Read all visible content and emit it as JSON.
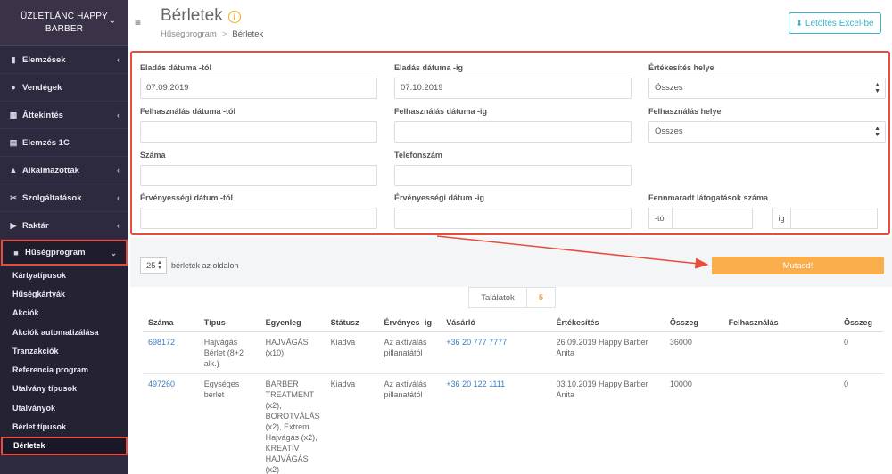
{
  "brand": {
    "title": "ÜZLETLÁNC HAPPY BARBER"
  },
  "sidebar": {
    "items": [
      {
        "label": "Elemzések",
        "icon": "bar-chart-icon",
        "glyph": "▮",
        "chevron": true
      },
      {
        "label": "Vendégek",
        "icon": "users-icon",
        "glyph": "●",
        "chevron": false
      },
      {
        "label": "Áttekintés",
        "icon": "grid-icon",
        "glyph": "▦",
        "chevron": true
      },
      {
        "label": "Elemzés 1C",
        "icon": "document-icon",
        "glyph": "▤",
        "chevron": false
      },
      {
        "label": "Alkalmazottak",
        "icon": "user-icon",
        "glyph": "▲",
        "chevron": true
      },
      {
        "label": "Szolgáltatások",
        "icon": "scissors-icon",
        "glyph": "✂",
        "chevron": true
      },
      {
        "label": "Raktár",
        "icon": "truck-icon",
        "glyph": "▶",
        "chevron": true
      },
      {
        "label": "Hűségprogram",
        "icon": "gift-icon",
        "glyph": "■",
        "chevron": true,
        "active": true
      }
    ],
    "subitems": [
      "Kártyatípusok",
      "Hűségkártyák",
      "Akciók",
      "Akciók automatizálása",
      "Tranzakciók",
      "Referencia program",
      "Utalvány típusok",
      "Utalványok",
      "Bérlet típusok",
      "Bérletek"
    ],
    "active_sub": "Bérletek"
  },
  "header": {
    "title": "Bérletek",
    "breadcrumb": [
      "Hűségprogram",
      "Bérletek"
    ],
    "excel_label": "Letöltés Excel-be"
  },
  "filters": {
    "sale_from": {
      "label": "Eladás dátuma -tól",
      "value": "07.09.2019"
    },
    "sale_to": {
      "label": "Eladás dátuma -ig",
      "value": "07.10.2019"
    },
    "sale_place": {
      "label": "Értékesítés helye",
      "value": "Összes"
    },
    "use_from": {
      "label": "Felhasználás dátuma -tól",
      "value": ""
    },
    "use_to": {
      "label": "Felhasználás dátuma -ig",
      "value": ""
    },
    "use_place": {
      "label": "Felhasználás helye",
      "value": "Összes"
    },
    "number": {
      "label": "Száma",
      "value": ""
    },
    "phone": {
      "label": "Telefonszám",
      "value": ""
    },
    "valid_from": {
      "label": "Érvényességi dátum -tól",
      "value": ""
    },
    "valid_to": {
      "label": "Érvényességi dátum -ig",
      "value": ""
    },
    "visits": {
      "label": "Fennmaradt látogatások száma",
      "from": "-tól",
      "to": "ig"
    }
  },
  "perpage": {
    "value": "25",
    "label": "bérletek az oldalon"
  },
  "show_button": "Mutasd!",
  "results": {
    "label": "Találatok",
    "count": "5"
  },
  "table": {
    "headers": [
      "Száma",
      "Típus",
      "Egyenleg",
      "Státusz",
      "Érvényes -ig",
      "Vásárló",
      "Értékesítés",
      "Összeg",
      "Felhasználás",
      "Összeg"
    ],
    "rows": [
      [
        "698172",
        "Hajvágás Bérlet (8+2 alk.)",
        "HAJVÁGÁS (x10)",
        "Kiadva",
        "Az aktiválás pillanatától",
        "+36 20 777 7777",
        "26.09.2019 Happy Barber Anita",
        "36000",
        "",
        "0"
      ],
      [
        "497260",
        "Egységes bérlet",
        "BARBER TREATMENT (x2), BOROTVÁLÁS (x2), Extrem Hajvágás (x2), KREATÍV HAJVÁGÁS (x2)",
        "Kiadva",
        "Az aktiválás pillanatától",
        "+36 20 122 1111",
        "03.10.2019 Happy Barber Anita",
        "10000",
        "",
        "0"
      ]
    ]
  }
}
